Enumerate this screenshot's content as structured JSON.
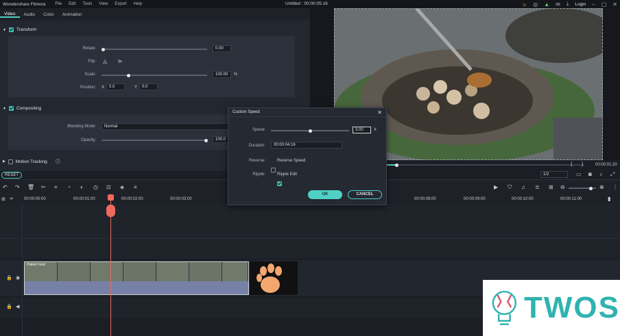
{
  "app": {
    "name": "Wondershare Filmora",
    "title": "Untitled : 00:00:05:16",
    "login": "Login"
  },
  "menu": [
    "File",
    "Edit",
    "Tools",
    "View",
    "Export",
    "Help"
  ],
  "tabs": [
    "Video",
    "Audio",
    "Color",
    "Animation"
  ],
  "transform": {
    "header": "Transform",
    "rotate_label": "Rotate:",
    "rotate_value": "0.00",
    "flip_label": "Flip:",
    "scale_label": "Scale:",
    "scale_value": "100.00",
    "scale_unit": "%",
    "position_label": "Position:",
    "x_label": "X",
    "x_value": "0.0",
    "y_label": "Y",
    "y_value": "0.0"
  },
  "compositing": {
    "header": "Compositing",
    "blend_label": "Blending Mode:",
    "blend_value": "Normal",
    "opacity_label": "Opacity:",
    "opacity_value": "100.0"
  },
  "motion_tracking": "Motion Tracking",
  "reset_label": "RESET",
  "preview": {
    "time": "00:00:01:20",
    "ratio": "1/2"
  },
  "ruler": [
    "00:00:00:00",
    "00:00:01:00",
    "00:00:02:00",
    "00:00:03:00",
    "00:00:08:00",
    "00:00:09:00",
    "00:00:10:00",
    "00:00:11:00"
  ],
  "clip_label": "Plated Food",
  "dialog": {
    "title": "Custom Speed",
    "speed_label": "Speed:",
    "speed_value": "3.00",
    "speed_unit": "X",
    "speed_fraction": 0.5,
    "duration_label": "Duration:",
    "duration_value": "00:00:04:16",
    "reverse_label": "Reverse:",
    "reverse_option": "Reverse Speed",
    "ripple_label": "Ripple:",
    "ripple_option": "Ripple Edit",
    "ok": "OK",
    "cancel": "CANCEL"
  },
  "watermark": {
    "text": "TWOS"
  },
  "colors": {
    "accent": "#4fd1c5",
    "playhead": "#ef6a5a",
    "watermark": "#2fb3b0"
  }
}
